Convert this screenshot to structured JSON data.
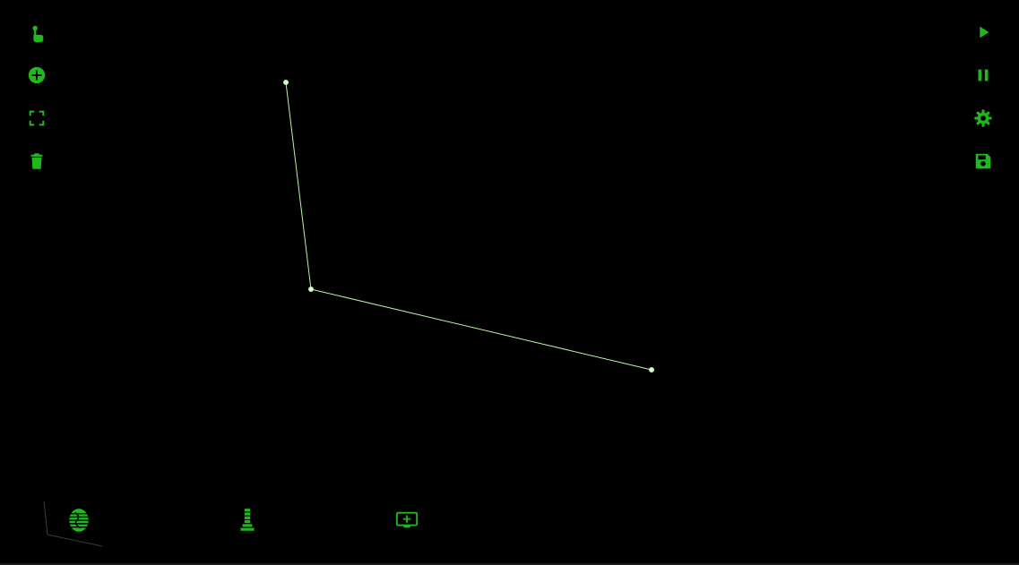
{
  "colors": {
    "accent": "#1fb81f",
    "line": "#b6f7a8",
    "background": "#000000"
  },
  "toolbar_left": {
    "items": [
      "touch-icon",
      "add-circle-icon",
      "fullscreen-icon",
      "trash-icon"
    ]
  },
  "toolbar_right": {
    "items": [
      "play-icon",
      "pause-icon",
      "settings-icon",
      "save-icon"
    ]
  },
  "bottom_bar": {
    "items": [
      "globe-stack-icon",
      "tower-stack-icon",
      "add-screen-icon"
    ]
  }
}
